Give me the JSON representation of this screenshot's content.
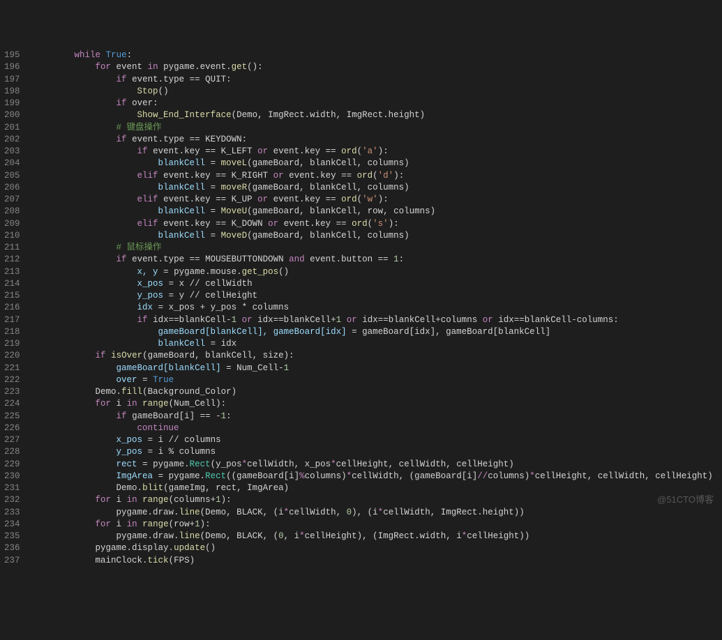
{
  "watermark": "@51CTO博客",
  "startLine": 195,
  "lines": [
    {
      "indent": 8,
      "tokens": [
        [
          "kw",
          "while"
        ],
        [
          "op",
          " "
        ],
        [
          "bool",
          "True"
        ],
        [
          "punct",
          ":"
        ]
      ]
    },
    {
      "indent": 12,
      "tokens": [
        [
          "kw",
          "for"
        ],
        [
          "op",
          " event "
        ],
        [
          "kw",
          "in"
        ],
        [
          "op",
          " pygame.event."
        ],
        [
          "fn",
          "get"
        ],
        [
          "punct",
          "():"
        ]
      ]
    },
    {
      "indent": 16,
      "tokens": [
        [
          "kw",
          "if"
        ],
        [
          "op",
          " event.type == QUIT:"
        ]
      ]
    },
    {
      "indent": 20,
      "tokens": [
        [
          "fn",
          "Stop"
        ],
        [
          "punct",
          "()"
        ]
      ]
    },
    {
      "indent": 16,
      "tokens": [
        [
          "kw",
          "if"
        ],
        [
          "op",
          " over:"
        ]
      ]
    },
    {
      "indent": 20,
      "tokens": [
        [
          "fn",
          "Show_End_Interface"
        ],
        [
          "punct",
          "(Demo, ImgRect.width, ImgRect.height)"
        ]
      ]
    },
    {
      "indent": 16,
      "tokens": [
        [
          "cmt",
          "# 键盘操作"
        ]
      ]
    },
    {
      "indent": 16,
      "tokens": [
        [
          "kw",
          "if"
        ],
        [
          "op",
          " event.type == KEYDOWN:"
        ]
      ]
    },
    {
      "indent": 20,
      "tokens": [
        [
          "kw",
          "if"
        ],
        [
          "op",
          " event.key == K_LEFT "
        ],
        [
          "kw",
          "or"
        ],
        [
          "op",
          " event.key == "
        ],
        [
          "fn",
          "ord"
        ],
        [
          "punct",
          "("
        ],
        [
          "str",
          "'a'"
        ],
        [
          "punct",
          "):"
        ]
      ]
    },
    {
      "indent": 24,
      "tokens": [
        [
          "const",
          "blankCell"
        ],
        [
          "op",
          " = "
        ],
        [
          "fn",
          "moveL"
        ],
        [
          "punct",
          "(gameBoard, blankCell, columns)"
        ]
      ]
    },
    {
      "indent": 20,
      "tokens": [
        [
          "kw",
          "elif"
        ],
        [
          "op",
          " event.key == K_RIGHT "
        ],
        [
          "kw",
          "or"
        ],
        [
          "op",
          " event.key == "
        ],
        [
          "fn",
          "ord"
        ],
        [
          "punct",
          "("
        ],
        [
          "str",
          "'d'"
        ],
        [
          "punct",
          "):"
        ]
      ]
    },
    {
      "indent": 24,
      "tokens": [
        [
          "const",
          "blankCell"
        ],
        [
          "op",
          " = "
        ],
        [
          "fn",
          "moveR"
        ],
        [
          "punct",
          "(gameBoard, blankCell, columns)"
        ]
      ]
    },
    {
      "indent": 20,
      "tokens": [
        [
          "kw",
          "elif"
        ],
        [
          "op",
          " event.key == K_UP "
        ],
        [
          "kw",
          "or"
        ],
        [
          "op",
          " event.key == "
        ],
        [
          "fn",
          "ord"
        ],
        [
          "punct",
          "("
        ],
        [
          "str",
          "'w'"
        ],
        [
          "punct",
          "):"
        ]
      ]
    },
    {
      "indent": 24,
      "tokens": [
        [
          "const",
          "blankCell"
        ],
        [
          "op",
          " = "
        ],
        [
          "fn",
          "MoveU"
        ],
        [
          "punct",
          "(gameBoard, blankCell, row, columns)"
        ]
      ]
    },
    {
      "indent": 20,
      "tokens": [
        [
          "kw",
          "elif"
        ],
        [
          "op",
          " event.key == K_DOWN "
        ],
        [
          "kw",
          "or"
        ],
        [
          "op",
          " event.key == "
        ],
        [
          "fn",
          "ord"
        ],
        [
          "punct",
          "("
        ],
        [
          "str",
          "'s'"
        ],
        [
          "punct",
          "):"
        ]
      ]
    },
    {
      "indent": 24,
      "tokens": [
        [
          "const",
          "blankCell"
        ],
        [
          "op",
          " = "
        ],
        [
          "fn",
          "MoveD"
        ],
        [
          "punct",
          "(gameBoard, blankCell, columns)"
        ]
      ]
    },
    {
      "indent": 16,
      "tokens": [
        [
          "cmt",
          "# 鼠标操作"
        ]
      ]
    },
    {
      "indent": 16,
      "tokens": [
        [
          "kw",
          "if"
        ],
        [
          "op",
          " event.type == MOUSEBUTTONDOWN "
        ],
        [
          "kw",
          "and"
        ],
        [
          "op",
          " event.button == "
        ],
        [
          "num",
          "1"
        ],
        [
          "punct",
          ":"
        ]
      ]
    },
    {
      "indent": 20,
      "tokens": [
        [
          "const",
          "x, y"
        ],
        [
          "op",
          " = pygame.mouse."
        ],
        [
          "fn",
          "get_pos"
        ],
        [
          "punct",
          "()"
        ]
      ]
    },
    {
      "indent": 20,
      "tokens": [
        [
          "const",
          "x_pos"
        ],
        [
          "op",
          " = x "
        ],
        [
          "punct",
          "//"
        ],
        [
          "op",
          " cellWidth"
        ]
      ]
    },
    {
      "indent": 20,
      "tokens": [
        [
          "const",
          "y_pos"
        ],
        [
          "op",
          " = y "
        ],
        [
          "punct",
          "//"
        ],
        [
          "op",
          " cellHeight"
        ]
      ]
    },
    {
      "indent": 20,
      "tokens": [
        [
          "const",
          "idx"
        ],
        [
          "op",
          " = x_pos + y_pos * columns"
        ]
      ]
    },
    {
      "indent": 20,
      "tokens": [
        [
          "kw",
          "if"
        ],
        [
          "op",
          " idx==blankCell-"
        ],
        [
          "num",
          "1"
        ],
        [
          "op",
          " "
        ],
        [
          "kw",
          "or"
        ],
        [
          "op",
          " idx==blankCell+"
        ],
        [
          "num",
          "1"
        ],
        [
          "op",
          " "
        ],
        [
          "kw",
          "or"
        ],
        [
          "op",
          " idx==blankCell+columns "
        ],
        [
          "kw",
          "or"
        ],
        [
          "op",
          " idx==blankCell-columns:"
        ]
      ]
    },
    {
      "indent": 24,
      "tokens": [
        [
          "const",
          "gameBoard[blankCell], gameBoard[idx]"
        ],
        [
          "op",
          " = gameBoard[idx], gameBoard[blankCell]"
        ]
      ]
    },
    {
      "indent": 24,
      "tokens": [
        [
          "const",
          "blankCell"
        ],
        [
          "op",
          " = idx"
        ]
      ]
    },
    {
      "indent": 12,
      "tokens": [
        [
          "kw",
          "if"
        ],
        [
          "op",
          " "
        ],
        [
          "fn",
          "isOver"
        ],
        [
          "punct",
          "(gameBoard, blankCell, size):"
        ]
      ]
    },
    {
      "indent": 16,
      "tokens": [
        [
          "const",
          "gameBoard[blankCell]"
        ],
        [
          "op",
          " = Num_Cell-"
        ],
        [
          "num",
          "1"
        ]
      ]
    },
    {
      "indent": 16,
      "tokens": [
        [
          "const",
          "over"
        ],
        [
          "op",
          " = "
        ],
        [
          "bool",
          "True"
        ]
      ]
    },
    {
      "indent": 12,
      "tokens": [
        [
          "op",
          "Demo."
        ],
        [
          "fn",
          "fill"
        ],
        [
          "punct",
          "(Background_Color)"
        ]
      ]
    },
    {
      "indent": 12,
      "tokens": [
        [
          "kw",
          "for"
        ],
        [
          "op",
          " i "
        ],
        [
          "kw",
          "in"
        ],
        [
          "op",
          " "
        ],
        [
          "fn",
          "range"
        ],
        [
          "punct",
          "(Num_Cell):"
        ]
      ]
    },
    {
      "indent": 16,
      "tokens": [
        [
          "kw",
          "if"
        ],
        [
          "op",
          " gameBoard[i] == -"
        ],
        [
          "num",
          "1"
        ],
        [
          "punct",
          ":"
        ]
      ]
    },
    {
      "indent": 20,
      "tokens": [
        [
          "kw",
          "continue"
        ]
      ]
    },
    {
      "indent": 16,
      "tokens": [
        [
          "const",
          "x_pos"
        ],
        [
          "op",
          " = i "
        ],
        [
          "punct",
          "//"
        ],
        [
          "op",
          " columns"
        ]
      ]
    },
    {
      "indent": 16,
      "tokens": [
        [
          "const",
          "y_pos"
        ],
        [
          "op",
          " = i "
        ],
        [
          "punct",
          "%"
        ],
        [
          "op",
          " columns"
        ]
      ]
    },
    {
      "indent": 16,
      "tokens": [
        [
          "const",
          "rect"
        ],
        [
          "op",
          " = pygame."
        ],
        [
          "cls",
          "Rect"
        ],
        [
          "punct",
          "(y_pos"
        ],
        [
          "kw",
          "*"
        ],
        [
          "punct",
          "cellWidth, x_pos"
        ],
        [
          "kw",
          "*"
        ],
        [
          "punct",
          "cellHeight, cellWidth, cellHeight)"
        ]
      ]
    },
    {
      "indent": 16,
      "tokens": [
        [
          "const",
          "ImgArea"
        ],
        [
          "op",
          " = pygame."
        ],
        [
          "cls",
          "Rect"
        ],
        [
          "punct",
          "((gameBoard[i]"
        ],
        [
          "kw",
          "%"
        ],
        [
          "punct",
          "columns)"
        ],
        [
          "kw",
          "*"
        ],
        [
          "punct",
          "cellWidth, (gameBoard[i]"
        ],
        [
          "kw",
          "//"
        ],
        [
          "punct",
          "columns)"
        ],
        [
          "kw",
          "*"
        ],
        [
          "punct",
          "cellHeight, cellWidth, cellHeight)"
        ]
      ]
    },
    {
      "indent": 16,
      "tokens": [
        [
          "op",
          "Demo."
        ],
        [
          "fn",
          "blit"
        ],
        [
          "punct",
          "(gameImg, rect, ImgArea)"
        ]
      ]
    },
    {
      "indent": 12,
      "tokens": [
        [
          "kw",
          "for"
        ],
        [
          "op",
          " i "
        ],
        [
          "kw",
          "in"
        ],
        [
          "op",
          " "
        ],
        [
          "fn",
          "range"
        ],
        [
          "punct",
          "(columns+"
        ],
        [
          "num",
          "1"
        ],
        [
          "punct",
          "):"
        ]
      ]
    },
    {
      "indent": 16,
      "tokens": [
        [
          "op",
          "pygame.draw."
        ],
        [
          "fn",
          "line"
        ],
        [
          "punct",
          "(Demo, BLACK, (i"
        ],
        [
          "kw",
          "*"
        ],
        [
          "punct",
          "cellWidth, "
        ],
        [
          "num",
          "0"
        ],
        [
          "punct",
          "), (i"
        ],
        [
          "kw",
          "*"
        ],
        [
          "punct",
          "cellWidth, ImgRect.height))"
        ]
      ]
    },
    {
      "indent": 12,
      "tokens": [
        [
          "kw",
          "for"
        ],
        [
          "op",
          " i "
        ],
        [
          "kw",
          "in"
        ],
        [
          "op",
          " "
        ],
        [
          "fn",
          "range"
        ],
        [
          "punct",
          "(row+"
        ],
        [
          "num",
          "1"
        ],
        [
          "punct",
          "):"
        ]
      ]
    },
    {
      "indent": 16,
      "tokens": [
        [
          "op",
          "pygame.draw."
        ],
        [
          "fn",
          "line"
        ],
        [
          "punct",
          "(Demo, BLACK, ("
        ],
        [
          "num",
          "0"
        ],
        [
          "punct",
          ", i"
        ],
        [
          "kw",
          "*"
        ],
        [
          "punct",
          "cellHeight), (ImgRect.width, i"
        ],
        [
          "kw",
          "*"
        ],
        [
          "punct",
          "cellHeight))"
        ]
      ]
    },
    {
      "indent": 12,
      "tokens": [
        [
          "op",
          "pygame.display."
        ],
        [
          "fn",
          "update"
        ],
        [
          "punct",
          "()"
        ]
      ]
    },
    {
      "indent": 12,
      "tokens": [
        [
          "op",
          "mainClock."
        ],
        [
          "fn",
          "tick"
        ],
        [
          "punct",
          "(FPS)"
        ]
      ]
    }
  ]
}
